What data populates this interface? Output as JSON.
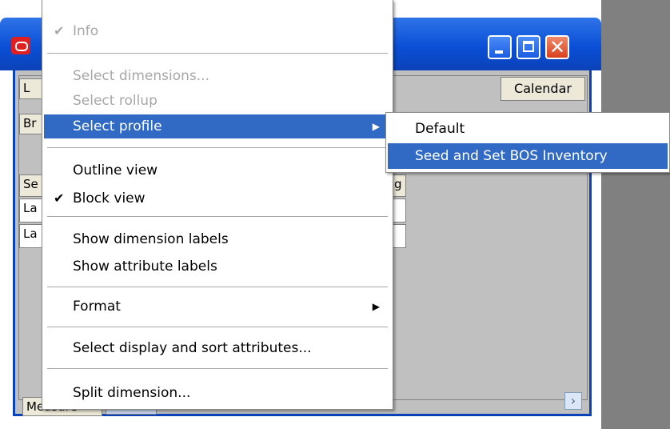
{
  "window": {
    "calendar_button": "Calendar",
    "bg_fragments": [
      "L",
      "Br",
      "Se",
      "La",
      "La",
      "g"
    ],
    "measure_tab": "Measure",
    "scroll_right": "›"
  },
  "menu": {
    "items": [
      {
        "label": "Info",
        "checked": true,
        "disabled": true
      },
      {
        "label": "Select dimensions...",
        "disabled": true
      },
      {
        "label": "Select rollup",
        "disabled": true
      },
      {
        "label": "Select profile",
        "highlighted": true,
        "submenu": true
      },
      {
        "label": "Outline view"
      },
      {
        "label": "Block view",
        "checked": true
      },
      {
        "label": "Show dimension labels"
      },
      {
        "label": "Show attribute labels"
      },
      {
        "label": "Format",
        "submenu": true
      },
      {
        "label": "Select display and sort attributes..."
      },
      {
        "label": "Split dimension..."
      }
    ],
    "check_glyph": "✔",
    "arrow_glyph": "▶"
  },
  "submenu": {
    "items": [
      {
        "label": "Default"
      },
      {
        "label": "Seed and Set BOS Inventory",
        "highlighted": true
      }
    ]
  },
  "colors": {
    "highlight": "#316ac5",
    "titlebar": "#0a4fd6",
    "close_button": "#d9401e",
    "disabled_text": "#a7a7a7"
  }
}
